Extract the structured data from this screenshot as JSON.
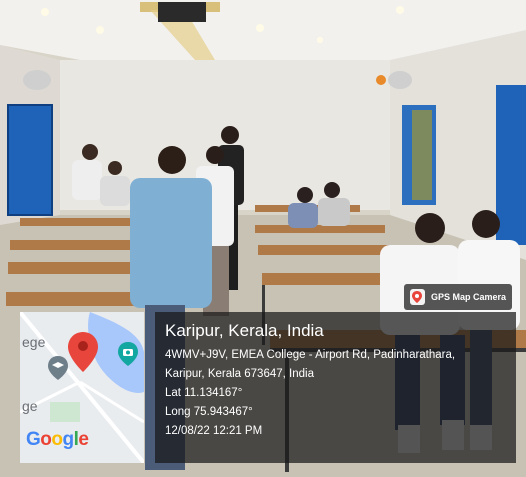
{
  "overlay": {
    "app_badge": "GPS Map Camera",
    "location_title": "Karipur, Kerala, India",
    "address_line1": "4WMV+J9V, EMEA College - Airport Rd, Padinharathara,",
    "address_line2": "Karipur, Kerala 673647, India",
    "latitude": "Lat 11.134167°",
    "longitude": "Long 75.943467°",
    "datetime": "12/08/22 12:21 PM"
  },
  "map": {
    "brand": "Google",
    "label_top": "ege",
    "label_bottom": "ge",
    "pin_color": "#e8453c"
  }
}
